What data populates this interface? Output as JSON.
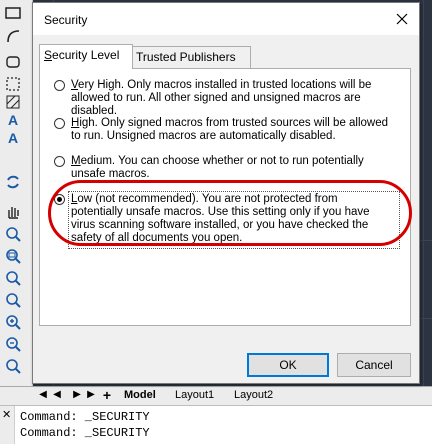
{
  "dialog": {
    "title": "Security",
    "tabs": [
      {
        "label": "Security Level",
        "accel": "S",
        "rest": "ecurity Level",
        "active": true
      },
      {
        "label": "Trusted Publishers",
        "accel": "",
        "rest": "Trusted Publishers",
        "active": false
      }
    ],
    "options": [
      {
        "accel": "V",
        "rest": "ery High. Only macros installed in trusted locations will be allowed to run. All other signed and unsigned macros are disabled.",
        "selected": false
      },
      {
        "accel": "H",
        "rest": "igh. Only signed macros from trusted sources will be allowed to run. Unsigned macros are automatically disabled.",
        "selected": false
      },
      {
        "accel": "M",
        "rest": "edium. You can choose whether or not to run potentially unsafe macros.",
        "selected": false
      },
      {
        "accel": "L",
        "rest": "ow (not recommended). You are not protected from potentially unsafe macros. Use this setting only if you have virus scanning software installed, or you have checked the safety of all documents you open.",
        "selected": true
      }
    ],
    "ok_label": "OK",
    "cancel_label": "Cancel",
    "highlight_color": "#d40000"
  },
  "layout_tabs": {
    "model": "Model",
    "layout1": "Layout1",
    "layout2": "Layout2"
  },
  "command_history": [
    "Command: _SECURITY",
    "Command: _SECURITY"
  ]
}
